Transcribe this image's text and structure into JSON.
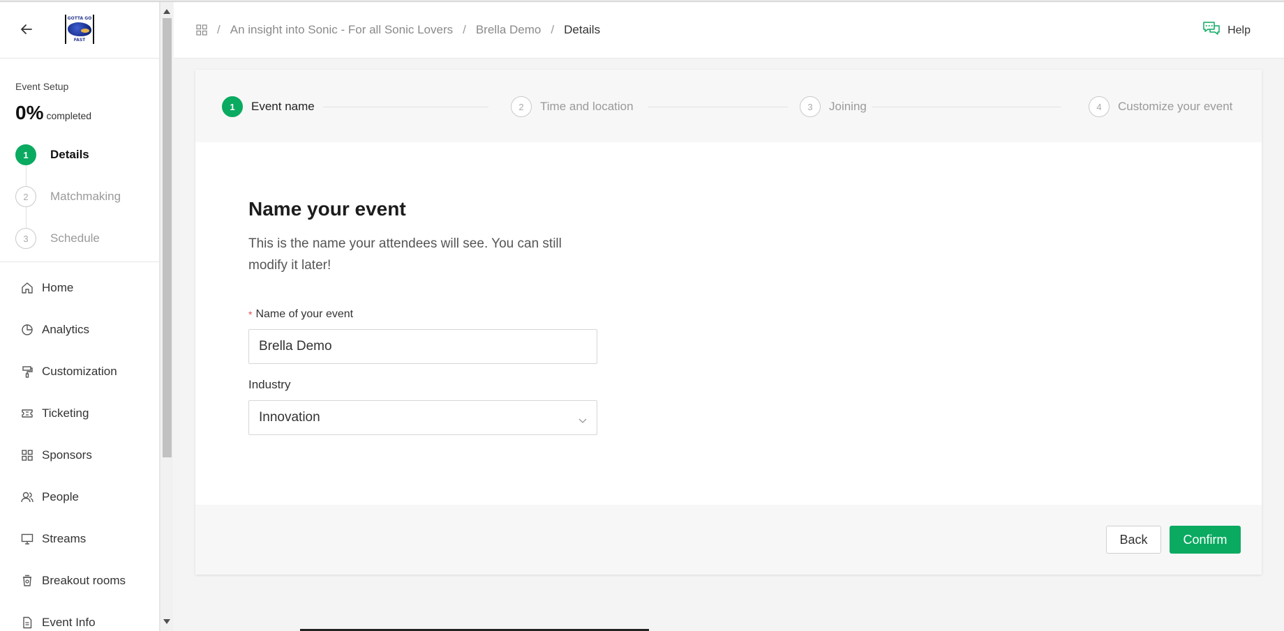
{
  "sidebar": {
    "logo_text_top": "GOTTA GO",
    "logo_text_bottom": "FAST",
    "setup_label": "Event Setup",
    "setup_pct": "0%",
    "setup_completed": "completed",
    "steps": [
      {
        "num": "1",
        "label": "Details"
      },
      {
        "num": "2",
        "label": "Matchmaking"
      },
      {
        "num": "3",
        "label": "Schedule"
      }
    ],
    "nav": [
      {
        "label": "Home",
        "icon": "home-icon"
      },
      {
        "label": "Analytics",
        "icon": "pie-chart-icon"
      },
      {
        "label": "Customization",
        "icon": "paint-roller-icon"
      },
      {
        "label": "Ticketing",
        "icon": "ticket-icon"
      },
      {
        "label": "Sponsors",
        "icon": "grid-icon"
      },
      {
        "label": "People",
        "icon": "people-icon"
      },
      {
        "label": "Streams",
        "icon": "monitor-icon"
      },
      {
        "label": "Breakout rooms",
        "icon": "cup-icon"
      },
      {
        "label": "Event Info",
        "icon": "document-icon"
      }
    ]
  },
  "header": {
    "breadcrumb": [
      "An insight into Sonic - For all Sonic Lovers",
      "Brella Demo",
      "Details"
    ],
    "help_label": "Help"
  },
  "wizard": {
    "steps": [
      {
        "num": "1",
        "label": "Event name"
      },
      {
        "num": "2",
        "label": "Time and location"
      },
      {
        "num": "3",
        "label": "Joining"
      },
      {
        "num": "4",
        "label": "Customize your event"
      }
    ]
  },
  "form": {
    "title": "Name your event",
    "description": "This is the name your attendees will see. You can still modify it later!",
    "required_mark": "*",
    "name_label": "Name of your event",
    "name_value": "Brella Demo",
    "industry_label": "Industry",
    "industry_value": "Innovation"
  },
  "footer": {
    "back_label": "Back",
    "confirm_label": "Confirm"
  },
  "colors": {
    "accent": "#0aaa61"
  }
}
